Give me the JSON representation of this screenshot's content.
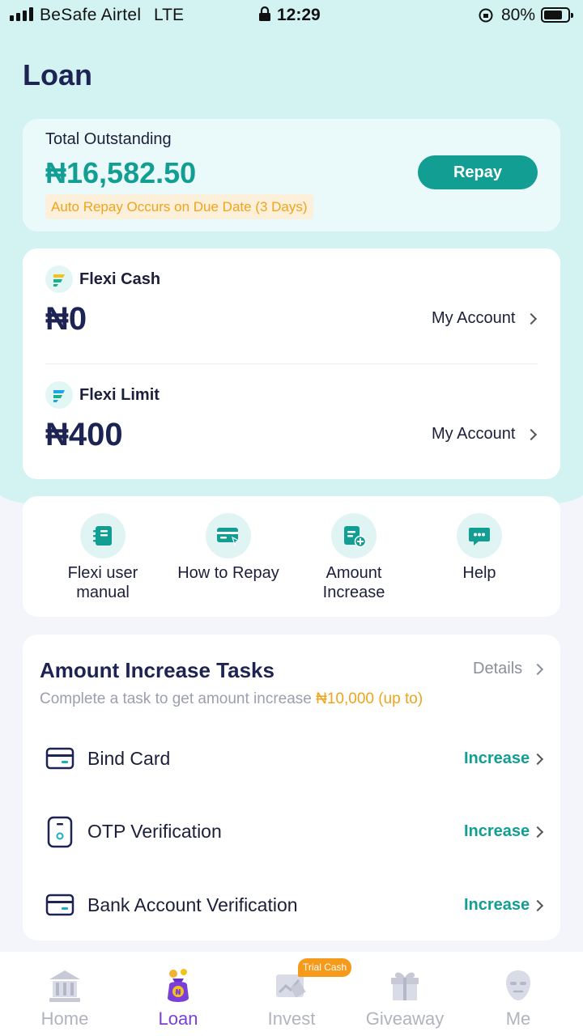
{
  "status_bar": {
    "carrier": "BeSafe Airtel",
    "network": "LTE",
    "time": "12:29",
    "battery": "80%"
  },
  "page_title": "Loan",
  "outstanding": {
    "label": "Total Outstanding",
    "amount": "₦16,582.50",
    "notice": "Auto Repay Occurs on Due Date (3 Days)",
    "repay_label": "Repay"
  },
  "accounts": [
    {
      "name": "Flexi Cash",
      "amount": "₦0",
      "link": "My Account"
    },
    {
      "name": "Flexi Limit",
      "amount": "₦400",
      "link": "My Account"
    }
  ],
  "shortcuts": [
    {
      "label": "Flexi user manual",
      "icon": "manual-icon"
    },
    {
      "label": "How to Repay",
      "icon": "card-repay-icon"
    },
    {
      "label": "Amount Increase",
      "icon": "document-plus-icon"
    },
    {
      "label": "Help",
      "icon": "chat-bubble-icon"
    }
  ],
  "tasks": {
    "title": "Amount Increase Tasks",
    "details_label": "Details",
    "subtitle_prefix": "Complete a task to get amount increase ",
    "subtitle_highlight": "₦10,000 (up to)",
    "items": [
      {
        "label": "Bind Card",
        "action": "Increase",
        "icon": "card-icon"
      },
      {
        "label": "OTP Verification",
        "action": "Increase",
        "icon": "phone-icon"
      },
      {
        "label": "Bank Account Verification",
        "action": "Increase",
        "icon": "bank-card-icon"
      }
    ]
  },
  "tabbar": {
    "badge": "Trial Cash",
    "items": [
      {
        "label": "Home",
        "icon": "bank-building-icon",
        "active": false
      },
      {
        "label": "Loan",
        "icon": "money-bag-icon",
        "active": true
      },
      {
        "label": "Invest",
        "icon": "chart-icon",
        "active": false
      },
      {
        "label": "Giveaway",
        "icon": "gift-icon",
        "active": false
      },
      {
        "label": "Me",
        "icon": "profile-icon",
        "active": false
      }
    ]
  },
  "colors": {
    "accent": "#139e93",
    "highlight": "#f1a31c",
    "active_tab": "#7a3fd8",
    "header_bg": "#d3f2f2"
  }
}
